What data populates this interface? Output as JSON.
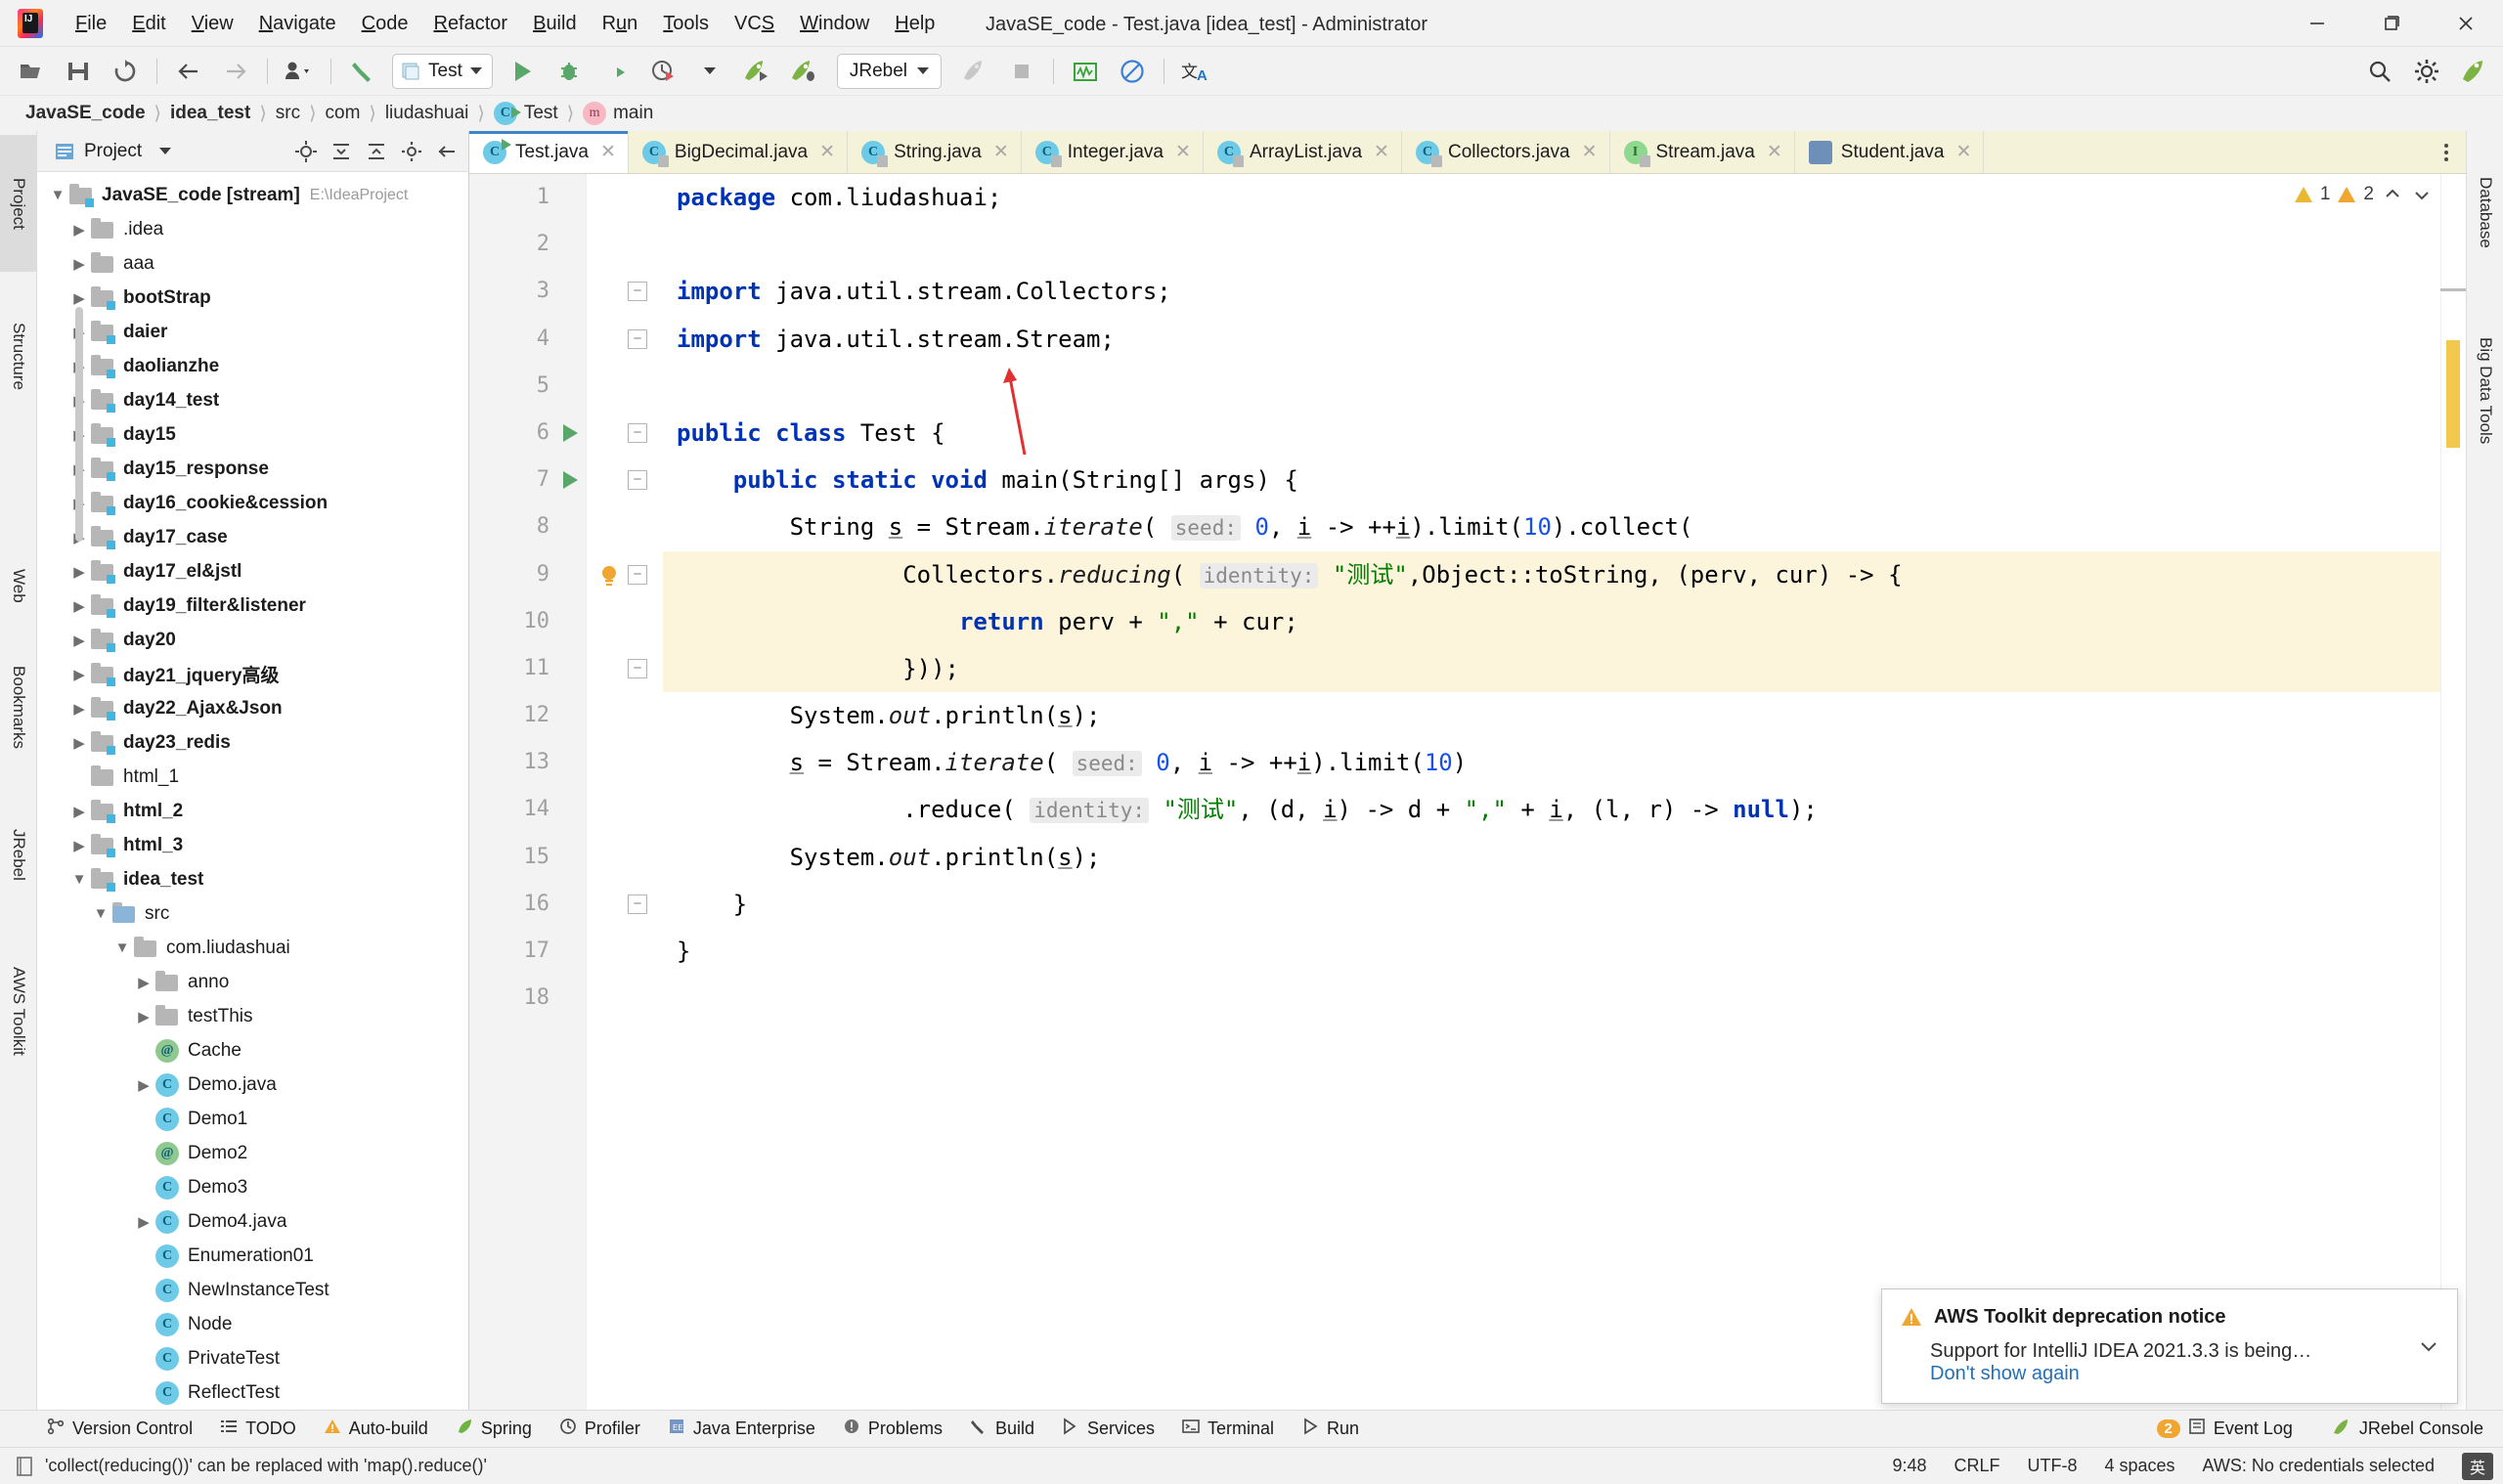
{
  "window": {
    "title": "JavaSE_code - Test.java [idea_test] - Administrator",
    "minimize": "–",
    "maximize": "❐",
    "close": "✕"
  },
  "menubar": {
    "items": [
      "File",
      "Edit",
      "View",
      "Navigate",
      "Code",
      "Refactor",
      "Build",
      "Run",
      "Tools",
      "VCS",
      "Window",
      "Help"
    ]
  },
  "toolbar": {
    "run_config": "Test",
    "jrebel_config": "JRebel",
    "icons": [
      "open-folder-icon",
      "save-icon",
      "sync-icon",
      "back-arrow-icon",
      "forward-arrow-icon",
      "profile-icon",
      "build-hammer-icon"
    ],
    "run_icons": [
      "run-icon",
      "debug-icon",
      "run-coverage-icon",
      "profile-run-icon",
      "jrebel-run-icon",
      "jrebel-debug-icon"
    ],
    "right_icons": [
      "search-icon",
      "settings-gear-icon",
      "jrebel-launch-icon"
    ],
    "extra_icons": [
      "jrebel-rocket-disabled-icon",
      "stop-icon",
      "activity-monitor-icon",
      "no-entry-icon",
      "translate-icon"
    ]
  },
  "breadcrumb": {
    "items": [
      {
        "label": "JavaSE_code",
        "bold": true,
        "icon": ""
      },
      {
        "label": "idea_test",
        "bold": true,
        "icon": ""
      },
      {
        "label": "src",
        "bold": false,
        "icon": ""
      },
      {
        "label": "com",
        "bold": false,
        "icon": ""
      },
      {
        "label": "liudashuai",
        "bold": false,
        "icon": ""
      },
      {
        "label": "Test",
        "bold": false,
        "icon": "class-icon"
      },
      {
        "label": "main",
        "bold": false,
        "icon": "method-icon"
      }
    ],
    "separator": "〉"
  },
  "left_strip": {
    "tabs": [
      "Project",
      "Structure",
      "Web",
      "Bookmarks",
      "JRebel",
      "AWS Toolkit"
    ]
  },
  "right_strip": {
    "tabs": [
      "Database",
      "Big Data Tools"
    ]
  },
  "project_panel": {
    "title": "Project",
    "header_icons": [
      "chevron-down-icon",
      "locate-icon",
      "collapse-all-icon",
      "expand-all-icon",
      "settings-gear-icon",
      "hide-icon",
      "more-options-icon"
    ],
    "tree": [
      {
        "depth": 0,
        "arrow": "down",
        "icon": "module-folder",
        "label": "JavaSE_code [stream]",
        "bold": true,
        "suffix": "E:\\IdeaProject"
      },
      {
        "depth": 1,
        "arrow": "right",
        "icon": "folder",
        "label": ".idea",
        "bold": false,
        "suffix": ""
      },
      {
        "depth": 1,
        "arrow": "right",
        "icon": "folder",
        "label": "aaa",
        "bold": false,
        "suffix": ""
      },
      {
        "depth": 1,
        "arrow": "right",
        "icon": "module-folder",
        "label": "bootStrap",
        "bold": true,
        "suffix": ""
      },
      {
        "depth": 1,
        "arrow": "right",
        "icon": "module-folder",
        "label": "daier",
        "bold": true,
        "suffix": ""
      },
      {
        "depth": 1,
        "arrow": "right",
        "icon": "module-folder",
        "label": "daolianzhe",
        "bold": true,
        "suffix": ""
      },
      {
        "depth": 1,
        "arrow": "right",
        "icon": "module-folder",
        "label": "day14_test",
        "bold": true,
        "suffix": ""
      },
      {
        "depth": 1,
        "arrow": "right",
        "icon": "module-folder",
        "label": "day15",
        "bold": true,
        "suffix": ""
      },
      {
        "depth": 1,
        "arrow": "right",
        "icon": "module-folder",
        "label": "day15_response",
        "bold": true,
        "suffix": ""
      },
      {
        "depth": 1,
        "arrow": "right",
        "icon": "module-folder",
        "label": "day16_cookie&cession",
        "bold": true,
        "suffix": ""
      },
      {
        "depth": 1,
        "arrow": "right",
        "icon": "module-folder",
        "label": "day17_case",
        "bold": true,
        "suffix": ""
      },
      {
        "depth": 1,
        "arrow": "right",
        "icon": "module-folder",
        "label": "day17_el&jstl",
        "bold": true,
        "suffix": ""
      },
      {
        "depth": 1,
        "arrow": "right",
        "icon": "module-folder",
        "label": "day19_filter&listener",
        "bold": true,
        "suffix": ""
      },
      {
        "depth": 1,
        "arrow": "right",
        "icon": "module-folder",
        "label": "day20",
        "bold": true,
        "suffix": ""
      },
      {
        "depth": 1,
        "arrow": "right",
        "icon": "module-folder",
        "label": "day21_jquery高级",
        "bold": true,
        "suffix": ""
      },
      {
        "depth": 1,
        "arrow": "right",
        "icon": "module-folder",
        "label": "day22_Ajax&Json",
        "bold": true,
        "suffix": ""
      },
      {
        "depth": 1,
        "arrow": "right",
        "icon": "module-folder",
        "label": "day23_redis",
        "bold": true,
        "suffix": ""
      },
      {
        "depth": 1,
        "arrow": "none",
        "icon": "folder",
        "label": "html_1",
        "bold": false,
        "suffix": ""
      },
      {
        "depth": 1,
        "arrow": "right",
        "icon": "module-folder",
        "label": "html_2",
        "bold": true,
        "suffix": ""
      },
      {
        "depth": 1,
        "arrow": "right",
        "icon": "module-folder",
        "label": "html_3",
        "bold": true,
        "suffix": ""
      },
      {
        "depth": 1,
        "arrow": "down",
        "icon": "module-folder",
        "label": "idea_test",
        "bold": true,
        "suffix": ""
      },
      {
        "depth": 2,
        "arrow": "down",
        "icon": "source-folder",
        "label": "src",
        "bold": false,
        "suffix": ""
      },
      {
        "depth": 3,
        "arrow": "down",
        "icon": "package",
        "label": "com.liudashuai",
        "bold": false,
        "suffix": ""
      },
      {
        "depth": 4,
        "arrow": "right",
        "icon": "package",
        "label": "anno",
        "bold": false,
        "suffix": ""
      },
      {
        "depth": 4,
        "arrow": "right",
        "icon": "package",
        "label": "testThis",
        "bold": false,
        "suffix": ""
      },
      {
        "depth": 4,
        "arrow": "none",
        "icon": "annotation-icon",
        "label": "Cache",
        "bold": false,
        "suffix": ""
      },
      {
        "depth": 4,
        "arrow": "right",
        "icon": "class-icon",
        "label": "Demo.java",
        "bold": false,
        "suffix": ""
      },
      {
        "depth": 4,
        "arrow": "none",
        "icon": "class-icon",
        "label": "Demo1",
        "bold": false,
        "suffix": ""
      },
      {
        "depth": 4,
        "arrow": "none",
        "icon": "annotation-icon",
        "label": "Demo2",
        "bold": false,
        "suffix": ""
      },
      {
        "depth": 4,
        "arrow": "none",
        "icon": "class-icon",
        "label": "Demo3",
        "bold": false,
        "suffix": ""
      },
      {
        "depth": 4,
        "arrow": "right",
        "icon": "class-icon",
        "label": "Demo4.java",
        "bold": false,
        "suffix": ""
      },
      {
        "depth": 4,
        "arrow": "none",
        "icon": "class-icon",
        "label": "Enumeration01",
        "bold": false,
        "suffix": ""
      },
      {
        "depth": 4,
        "arrow": "none",
        "icon": "class-icon",
        "label": "NewInstanceTest",
        "bold": false,
        "suffix": ""
      },
      {
        "depth": 4,
        "arrow": "none",
        "icon": "class-icon",
        "label": "Node",
        "bold": false,
        "suffix": ""
      },
      {
        "depth": 4,
        "arrow": "none",
        "icon": "class-icon",
        "label": "PrivateTest",
        "bold": false,
        "suffix": ""
      },
      {
        "depth": 4,
        "arrow": "none",
        "icon": "class-icon",
        "label": "ReflectTest",
        "bold": false,
        "suffix": ""
      }
    ]
  },
  "editor": {
    "tabs": [
      {
        "label": "Test.java",
        "icon": "class-runnable-icon",
        "active": true,
        "close": "✕"
      },
      {
        "label": "BigDecimal.java",
        "icon": "class-locked-icon",
        "active": false,
        "close": "✕"
      },
      {
        "label": "String.java",
        "icon": "class-locked-icon",
        "active": false,
        "close": "✕"
      },
      {
        "label": "Integer.java",
        "icon": "class-locked-icon",
        "active": false,
        "close": "✕"
      },
      {
        "label": "ArrayList.java",
        "icon": "class-locked-icon",
        "active": false,
        "close": "✕"
      },
      {
        "label": "Collectors.java",
        "icon": "class-locked-icon",
        "active": false,
        "close": "✕"
      },
      {
        "label": "Stream.java",
        "icon": "interface-locked-icon",
        "active": false,
        "close": "✕"
      },
      {
        "label": "Student.java",
        "icon": "student-icon",
        "active": false,
        "close": "✕"
      }
    ],
    "line_numbers": [
      "1",
      "2",
      "3",
      "4",
      "5",
      "6",
      "7",
      "8",
      "9",
      "10",
      "11",
      "12",
      "13",
      "14",
      "15",
      "16",
      "17",
      "18"
    ],
    "warnings": {
      "warn_count": "1",
      "weak_count": "2"
    },
    "code_lines": [
      "package com.liudashuai;",
      "",
      "import java.util.stream.Collectors;",
      "import java.util.stream.Stream;",
      "",
      "public class Test {",
      "    public static void main(String[] args) {",
      "        String s = Stream.iterate( seed: 0, i -> ++i).limit(10).collect(",
      "                Collectors.reducing( identity: \"测试\",Object::toString, (perv, cur) -> {",
      "                    return perv + \",\" + cur;",
      "                }));",
      "        System.out.println(s);",
      "        s = Stream.iterate( seed: 0, i -> ++i).limit(10)",
      "                .reduce( identity: \"测试\", (d, i) -> d + \",\" + i, (l, r) -> null);",
      "        System.out.println(s);",
      "    }",
      "}",
      ""
    ]
  },
  "notification": {
    "title": "AWS Toolkit deprecation notice",
    "body": "Support for IntelliJ IDEA 2021.3.3 is being…",
    "link": "Don't show again",
    "warn_icon": "warning-triangle-icon",
    "chevron": "chevron-down-icon"
  },
  "bottom_bar": {
    "items": [
      {
        "label": "Version Control",
        "icon": "branch-icon"
      },
      {
        "label": "TODO",
        "icon": "list-icon"
      },
      {
        "label": "Auto-build",
        "icon": "warning-triangle-icon"
      },
      {
        "label": "Spring",
        "icon": "spring-leaf-icon"
      },
      {
        "label": "Profiler",
        "icon": "profiler-icon"
      },
      {
        "label": "Java Enterprise",
        "icon": "java-ee-icon"
      },
      {
        "label": "Problems",
        "icon": "problems-icon"
      },
      {
        "label": "Build",
        "icon": "hammer-icon"
      },
      {
        "label": "Services",
        "icon": "services-icon"
      },
      {
        "label": "Terminal",
        "icon": "terminal-icon"
      },
      {
        "label": "Run",
        "icon": "run-icon"
      }
    ],
    "right": [
      {
        "label": "Event Log",
        "icon": "event-log-icon",
        "badge": "2"
      },
      {
        "label": "JRebel Console",
        "icon": "jrebel-icon",
        "badge": ""
      }
    ]
  },
  "status_bar": {
    "message": "'collect(reducing())' can be replaced with 'map().reduce()'",
    "message_icon": "inspection-icon",
    "caret_position": "9:48",
    "line_separator": "CRLF",
    "encoding": "UTF-8",
    "indent": "4 spaces",
    "aws": "AWS: No credentials selected",
    "ime": "英"
  },
  "colors": {
    "accent_blue": "#4083c9",
    "keyword": "#0033b3",
    "string": "#027d00",
    "number": "#1750eb",
    "highlight": "#fdf4dc",
    "tab_strip": "#f4f2d8",
    "warn_orange": "#f0a732",
    "run_green": "#59a869"
  }
}
